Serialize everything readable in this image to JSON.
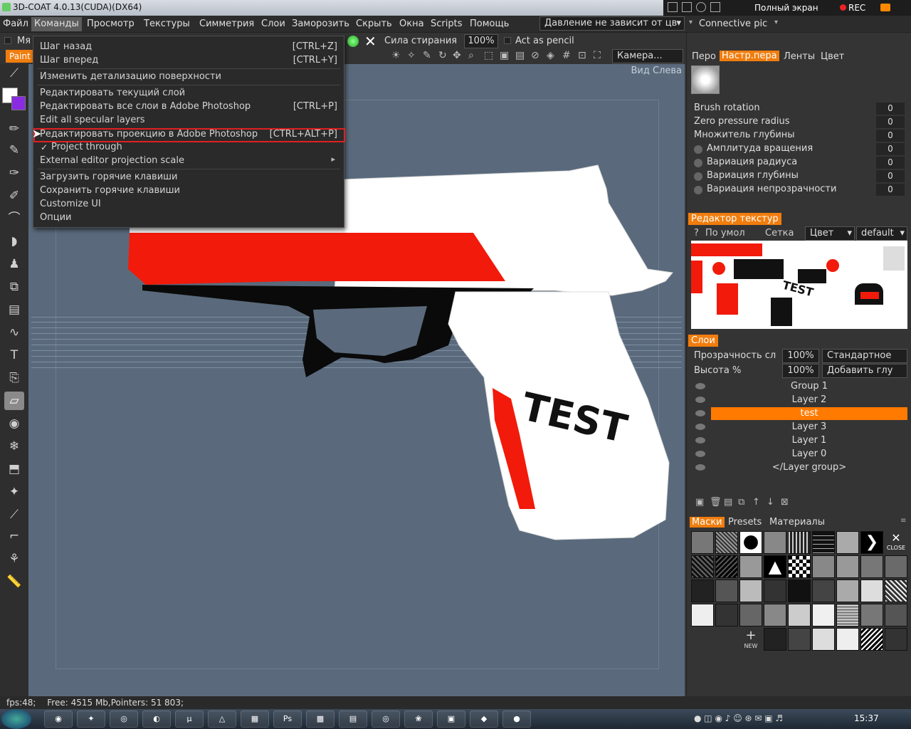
{
  "window": {
    "title": "3D-COAT 4.0.13(CUDA)(DX64)"
  },
  "recorder": {
    "fullscreen": "Полный экран",
    "rec": "REC"
  },
  "menu": {
    "items": [
      "Файл",
      "Команды",
      "Просмотр",
      "Текстуры",
      "Симметрия",
      "Слои",
      "Заморозить",
      "Скрыть",
      "Окна",
      "Scripts",
      "Помощь"
    ],
    "pressure_combo": "Давление не зависит от цв",
    "connective": "Connective pic"
  },
  "toolbar": {
    "tab": "Paint",
    "erase_label": "Сила стирания",
    "erase_value": "100%",
    "act_as_pencil": "Act as pencil",
    "camera": "Камера...",
    "partial_label": "Мя"
  },
  "viewport": {
    "label": "Вид Слева",
    "decal_text": "TEST"
  },
  "dropdown": {
    "items": [
      {
        "label": "Шаг назад",
        "shortcut": "[CTRL+Z]"
      },
      {
        "label": "Шаг вперед",
        "shortcut": "[CTRL+Y]"
      },
      {
        "label": "Изменить детализацию поверхности",
        "shortcut": ""
      },
      {
        "label": "Редактировать текущий слой",
        "shortcut": ""
      },
      {
        "label": "Редактировать все слои в Adobe Photoshop",
        "shortcut": "[CTRL+P]"
      },
      {
        "label": "Edit all specular layers",
        "shortcut": ""
      },
      {
        "label": "Редактировать проекцию в Adobe Photoshop",
        "shortcut": "[CTRL+ALT+P]"
      },
      {
        "label": "Project through",
        "shortcut": ""
      },
      {
        "label": "External editor projection scale",
        "shortcut": ""
      },
      {
        "label": "Загрузить горячие клавиши",
        "shortcut": ""
      },
      {
        "label": "Сохранить горячие клавиши",
        "shortcut": ""
      },
      {
        "label": "Customize UI",
        "shortcut": ""
      },
      {
        "label": "Опции",
        "shortcut": ""
      }
    ],
    "checked_item": "Project through",
    "highlighted_item": "Редактировать проекцию в Adobe Photoshop"
  },
  "panel": {
    "tabs": [
      "Перо",
      "Настр.пера",
      "Ленты",
      "Цвет"
    ],
    "active_tab": "Настр.пера",
    "brush_params": [
      {
        "label": "Brush rotation",
        "value": "0"
      },
      {
        "label": "Zero pressure radius",
        "value": "0"
      },
      {
        "label": "Множитель глубины",
        "value": "0"
      },
      {
        "label": "Амплитуда вращения",
        "value": "0"
      },
      {
        "label": "Вариация радиуса",
        "value": "0"
      },
      {
        "label": "Вариация глубины",
        "value": "0"
      },
      {
        "label": "Вариация непрозрачности",
        "value": "0"
      }
    ],
    "texture_editor": {
      "title": "Редактор текстур",
      "help": "?",
      "default": "По умол",
      "grid": "Сетка",
      "color": "Цвет",
      "preset": "default",
      "preview_text": "TEST"
    },
    "layers": {
      "title": "Слои",
      "opacity_label": "Прозрачность сл",
      "opacity_value": "100%",
      "blend": "Стандартное",
      "height_label": "Высота %",
      "height_value": "100%",
      "add_glow": "Добавить глу",
      "items": [
        "Group 1",
        "Layer 2",
        "test",
        "Layer 3",
        "Layer 1",
        "Layer 0",
        "</Layer group>"
      ],
      "selected": "test"
    },
    "masks": {
      "tabs": [
        "Маски",
        "Presets",
        "Материалы"
      ],
      "active": "Маски",
      "close": "CLOSE",
      "new": "NEW"
    }
  },
  "status": {
    "fps": "fps:48;",
    "memory": "Free: 4515 Mb,Pointers: 51 803;"
  },
  "taskbar": {
    "clock": "15:37",
    "ps_label": "Ps"
  },
  "colors": {
    "accent": "#f07d0e",
    "viewport_bg": "#5a6a7c",
    "gun_red": "#f21a0a",
    "highlight_border": "#e02020"
  }
}
